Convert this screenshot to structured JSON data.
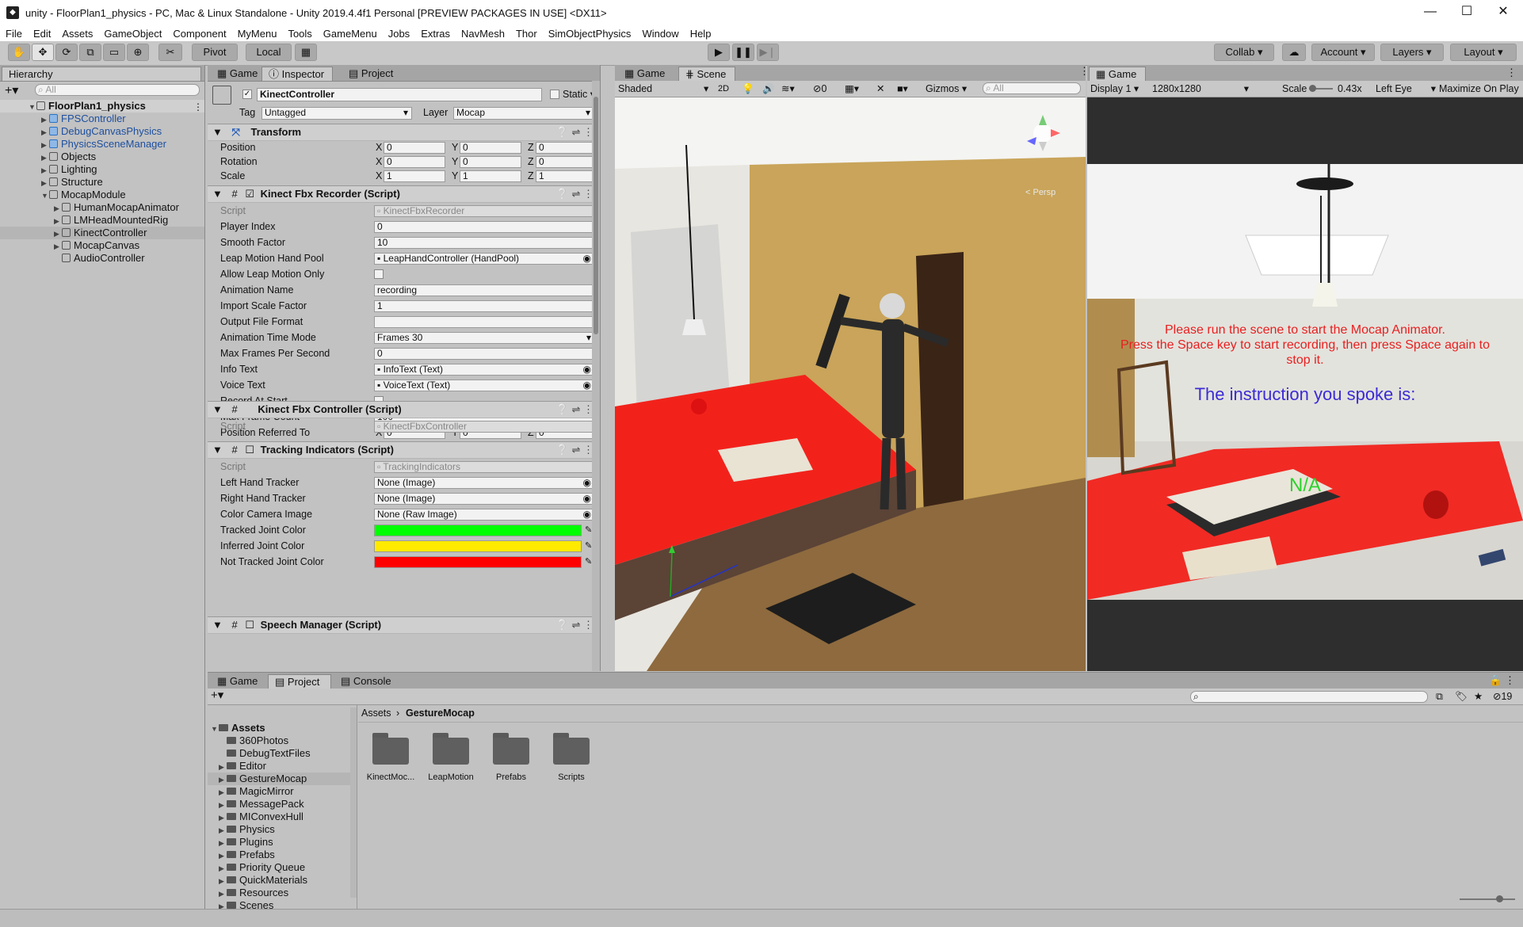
{
  "window": {
    "title": "unity - FloorPlan1_physics - PC, Mac & Linux Standalone - Unity 2019.4.4f1 Personal [PREVIEW PACKAGES IN USE] <DX11>",
    "minimize": "—",
    "maximize": "☐",
    "close": "✕"
  },
  "menu": [
    "File",
    "Edit",
    "Assets",
    "GameObject",
    "Component",
    "MyMenu",
    "Tools",
    "GameMenu",
    "Jobs",
    "Extras",
    "NavMesh",
    "Thor",
    "SimObjectPhysics",
    "Window",
    "Help"
  ],
  "toolbar": {
    "pivot": "Pivot",
    "local": "Local",
    "collab": "Collab ▾",
    "account": "Account",
    "layers": "Layers",
    "layout": "Layout"
  },
  "hierarchy": {
    "tab": "Hierarchy",
    "search_placeholder": "All",
    "scene": "FloorPlan1_physics",
    "items": [
      {
        "label": "FPSController",
        "prefab": true,
        "arrow": "▶"
      },
      {
        "label": "DebugCanvasPhysics",
        "prefab": true,
        "arrow": "▶"
      },
      {
        "label": "PhysicsSceneManager",
        "prefab": true,
        "arrow": "▶"
      },
      {
        "label": "Objects",
        "prefab": false,
        "arrow": "▶"
      },
      {
        "label": "Lighting",
        "prefab": false,
        "arrow": "▶"
      },
      {
        "label": "Structure",
        "prefab": false,
        "arrow": "▶"
      },
      {
        "label": "MocapModule",
        "prefab": false,
        "arrow": "▼"
      },
      {
        "label": "HumanMocapAnimator",
        "prefab": false,
        "arrow": "▶"
      },
      {
        "label": "LMHeadMountedRig",
        "prefab": false,
        "arrow": "▶"
      },
      {
        "label": "KinectController",
        "prefab": false,
        "arrow": "▶"
      },
      {
        "label": "MocapCanvas",
        "prefab": false,
        "arrow": "▶"
      },
      {
        "label": "AudioController",
        "prefab": false,
        "arrow": ""
      }
    ]
  },
  "inspector": {
    "tabs": [
      "Game",
      "Inspector",
      "Project"
    ],
    "object_name": "KinectController",
    "static_label": "Static",
    "tag_label": "Tag",
    "tag_value": "Untagged",
    "layer_label": "Layer",
    "layer_value": "Mocap",
    "transform": {
      "title": "Transform",
      "rows": [
        {
          "label": "Position",
          "x": "0",
          "y": "0",
          "z": "0"
        },
        {
          "label": "Rotation",
          "x": "0",
          "y": "0",
          "z": "0"
        },
        {
          "label": "Scale",
          "x": "1",
          "y": "1",
          "z": "1"
        }
      ]
    },
    "recorder": {
      "title": "Kinect Fbx Recorder (Script)",
      "script_label": "Script",
      "script_value": "KinectFbxRecorder",
      "rows": [
        {
          "label": "Player Index",
          "value": "0"
        },
        {
          "label": "Smooth Factor",
          "value": "10"
        },
        {
          "label": "Leap Motion Hand Pool",
          "value": "LeapHandController (HandPool)"
        },
        {
          "label": "Allow Leap Motion Only",
          "value": ""
        },
        {
          "label": "Animation Name",
          "value": "recording"
        },
        {
          "label": "Import Scale Factor",
          "value": "1"
        },
        {
          "label": "Output File Format",
          "value": ""
        },
        {
          "label": "Animation Time Mode",
          "value": "Frames 30"
        },
        {
          "label": "Max Frames Per Second",
          "value": "0"
        },
        {
          "label": "Info Text",
          "value": "InfoText (Text)"
        },
        {
          "label": "Voice Text",
          "value": "VoiceText (Text)"
        },
        {
          "label": "Record At Start",
          "value": ""
        },
        {
          "label": "Max Frame Count",
          "value": "100"
        }
      ],
      "pos_ref_label": "Position Referred To",
      "pos_ref": {
        "x": "0",
        "y": "0",
        "z": "0"
      }
    },
    "controller": {
      "title": "Kinect Fbx Controller (Script)",
      "script_label": "Script",
      "script_value": "KinectFbxController"
    },
    "tracking": {
      "title": "Tracking Indicators (Script)",
      "script_label": "Script",
      "script_value": "TrackingIndicators",
      "rows": [
        {
          "label": "Left Hand Tracker",
          "value": "None (Image)"
        },
        {
          "label": "Right Hand Tracker",
          "value": "None (Image)"
        },
        {
          "label": "Color Camera Image",
          "value": "None (Raw Image)"
        }
      ],
      "colors": [
        {
          "label": "Tracked Joint Color",
          "color": "#00ff00"
        },
        {
          "label": "Inferred Joint Color",
          "color": "#ffea00"
        },
        {
          "label": "Not Tracked Joint Color",
          "color": "#ff0000"
        }
      ]
    },
    "speech": {
      "title": "Speech Manager (Script)"
    }
  },
  "scene": {
    "tabs": [
      "Game",
      "Scene"
    ],
    "shading": "Shaded",
    "mode_2d": "2D",
    "hidden_count": "0",
    "gizmos": "Gizmos",
    "search_placeholder": "All",
    "persp": "< Persp"
  },
  "game": {
    "tab": "Game",
    "display": "Display 1",
    "resolution": "1280x1280",
    "scale_label": "Scale",
    "scale_value": "0.43x",
    "eye": "Left Eye",
    "maximize": "Maximize On Play",
    "msg_line1": "Please run the scene to start the Mocap Animator.",
    "msg_line2": "Press the Space key to start recording, then press Space again to",
    "msg_line3": "stop it.",
    "instruction": "The instruction you spoke is:",
    "na": "N/A"
  },
  "project": {
    "tabs": [
      "Game",
      "Project",
      "Console"
    ],
    "hidden_count": "19",
    "breadcrumb_root": "Assets",
    "breadcrumb_current": "GestureMocap",
    "tree_root": "Assets",
    "tree": [
      "360Photos",
      "DebugTextFiles",
      "Editor",
      "GestureMocap",
      "MagicMirror",
      "MessagePack",
      "MIConvexHull",
      "Physics",
      "Plugins",
      "Prefabs",
      "Priority Queue",
      "QuickMaterials",
      "Resources",
      "Scenes"
    ],
    "folders": [
      "KinectMoc...",
      "LeapMotion",
      "Prefabs",
      "Scripts"
    ]
  }
}
